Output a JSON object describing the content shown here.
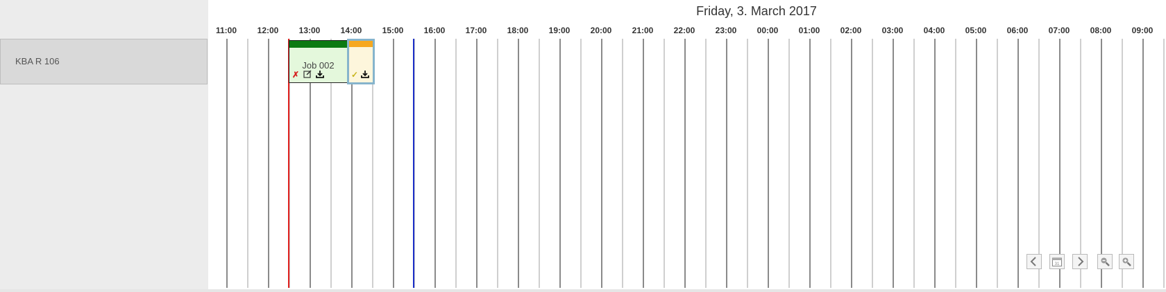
{
  "sidebar": {
    "resources": [
      {
        "label": "KBA R 106"
      }
    ]
  },
  "timeline": {
    "date_title": "Friday, 3. March 2017",
    "hours": [
      "11:00",
      "12:00",
      "13:00",
      "14:00",
      "15:00",
      "16:00",
      "17:00",
      "18:00",
      "19:00",
      "20:00",
      "21:00",
      "22:00",
      "23:00",
      "00:00",
      "01:00",
      "02:00",
      "03:00",
      "04:00",
      "05:00",
      "06:00",
      "07:00",
      "08:00",
      "09:00"
    ],
    "jobs": [
      {
        "label": "Job 002",
        "status_color": "#0c7a12",
        "icons": [
          "cancel-icon",
          "edit-icon",
          "download-icon"
        ]
      },
      {
        "label": "",
        "status_color": "#f6a820",
        "icons": [
          "check-icon",
          "download-icon"
        ]
      }
    ],
    "colors": {
      "now_line": "#e0201e",
      "marker_line": "#1a2ec8",
      "selected_border": "#86b4cc"
    }
  },
  "navigation": {
    "buttons": [
      "previous-icon",
      "calendar-icon",
      "next-icon",
      "zoom-out-icon",
      "zoom-in-icon"
    ],
    "calendar_day": "31"
  }
}
